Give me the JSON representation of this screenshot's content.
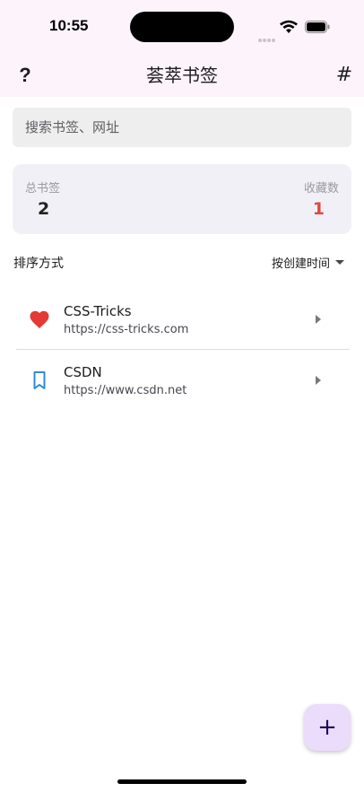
{
  "status_bar": {
    "time": "10:55"
  },
  "app_bar": {
    "title": "荟萃书签",
    "help_label": "?",
    "hash_label": "#"
  },
  "search": {
    "placeholder": "搜索书签、网址"
  },
  "stats": {
    "total_label": "总书签",
    "total_value": "2",
    "favorites_label": "收藏数",
    "favorites_value": "1",
    "favorites_color": "#e0493c"
  },
  "sort": {
    "label": "排序方式",
    "value": "按创建时间"
  },
  "bookmarks": [
    {
      "title": "CSS-Tricks",
      "url": "https://css-tricks.com",
      "icon": "heart-icon",
      "icon_color": "#e53935"
    },
    {
      "title": "CSDN",
      "url": "https://www.csdn.net",
      "icon": "bookmark-icon",
      "icon_color": "#2f8bd9"
    }
  ],
  "fab": {
    "label": "+"
  },
  "colors": {
    "topbar_bg": "#fcf3fb",
    "fab_bg": "#eadcfa"
  }
}
